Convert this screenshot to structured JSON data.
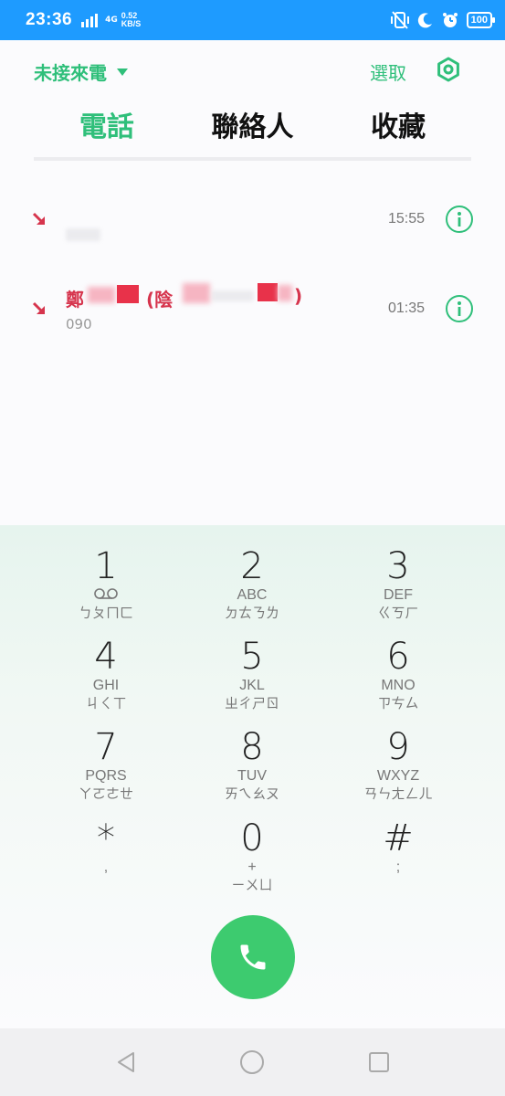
{
  "status_bar": {
    "time": "23:36",
    "network": "4G",
    "speed_value": "0.52",
    "speed_unit": "KB/S",
    "battery": "100"
  },
  "header": {
    "filter_label": "未接來電",
    "select_label": "選取"
  },
  "tabs": [
    {
      "label": "電話",
      "active": true
    },
    {
      "label": "聯絡人",
      "active": false
    },
    {
      "label": "收藏",
      "active": false
    }
  ],
  "calls": [
    {
      "name": "",
      "number": "",
      "time": "15:55"
    },
    {
      "name_prefix": "鄭",
      "name_mid": "(陰",
      "name_end": ")",
      "number": "090",
      "time": "01:35"
    }
  ],
  "dialpad": {
    "keys": [
      {
        "digit": "1",
        "letters": "",
        "bopomofo": "ㄅㄆㄇㄈ"
      },
      {
        "digit": "2",
        "letters": "ABC",
        "bopomofo": "ㄉㄊㄋㄌ"
      },
      {
        "digit": "3",
        "letters": "DEF",
        "bopomofo": "ㄍㄎㄏ"
      },
      {
        "digit": "4",
        "letters": "GHI",
        "bopomofo": "ㄐㄑㄒ"
      },
      {
        "digit": "5",
        "letters": "JKL",
        "bopomofo": "ㄓㄔㄕㄖ"
      },
      {
        "digit": "6",
        "letters": "MNO",
        "bopomofo": "ㄗㄘㄙ"
      },
      {
        "digit": "7",
        "letters": "PQRS",
        "bopomofo": "ㄚㄛㄜㄝ"
      },
      {
        "digit": "8",
        "letters": "TUV",
        "bopomofo": "ㄞㄟㄠㄡ"
      },
      {
        "digit": "9",
        "letters": "WXYZ",
        "bopomofo": "ㄢㄣㄤㄥㄦ"
      },
      {
        "digit": "*",
        "letters": ",",
        "bopomofo": ""
      },
      {
        "digit": "0",
        "letters": "+",
        "bopomofo": "ㄧㄨㄩ"
      },
      {
        "digit": "#",
        "letters": ";",
        "bopomofo": ""
      }
    ]
  },
  "colors": {
    "accent": "#2fbf7a",
    "missed": "#d6344d",
    "call_button": "#3dcb6f",
    "status_bar": "#1e9bff"
  },
  "icons": {
    "voicemail": "voicemail-icon",
    "call": "phone-icon",
    "settings": "gear-icon",
    "info": "info-icon",
    "missed_call": "missed-call-arrow-icon"
  }
}
